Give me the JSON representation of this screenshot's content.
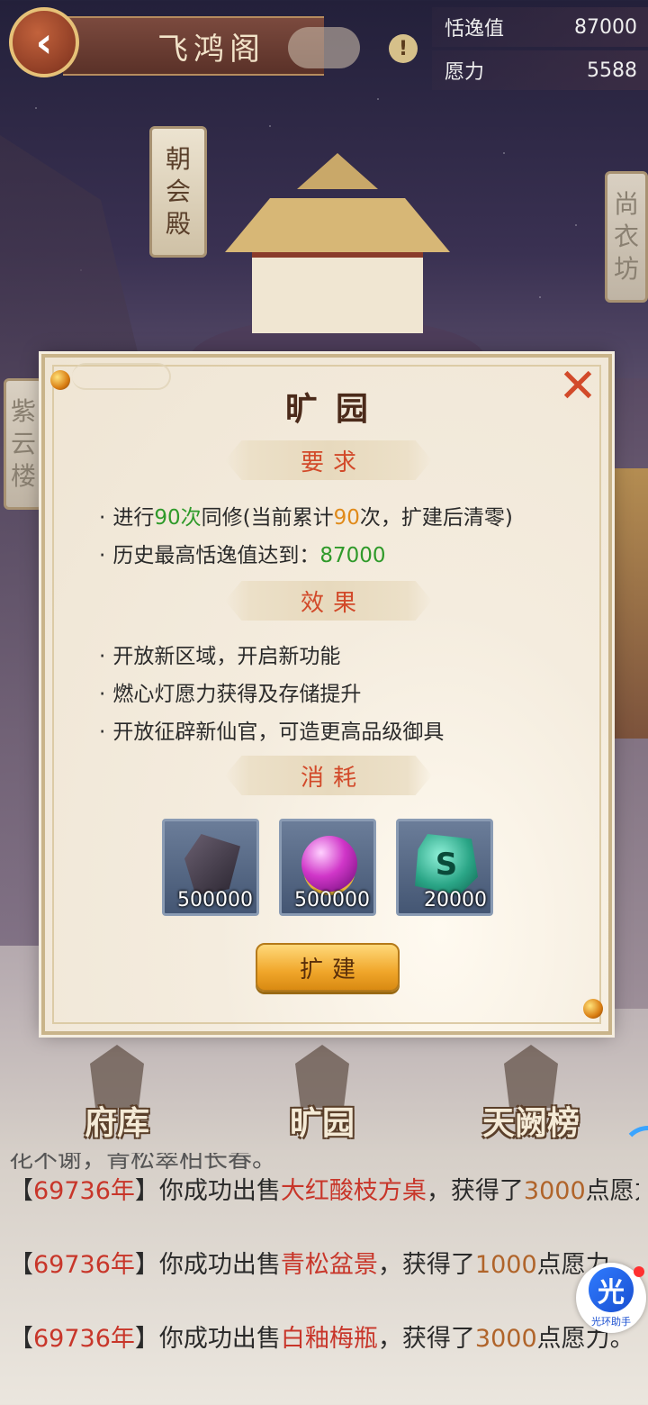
{
  "header": {
    "back_icon": "chevron-left-icon",
    "title": "飞鸿阁",
    "info_icon": "exclamation-icon",
    "stats": [
      {
        "label": "恬逸值",
        "value": "87000"
      },
      {
        "label": "愿力",
        "value": "5588"
      }
    ]
  },
  "scene_signs": {
    "chaohui": "朝会殿",
    "shangyi": "尚衣坊",
    "ziyun": "紫云楼"
  },
  "dialog": {
    "title": "旷园",
    "close_label": "✕",
    "requirements_head": "要求",
    "req1": {
      "prefix": "进行",
      "count": "90次",
      "mid": "同修(当前累计",
      "current": "90",
      "suffix": "次，扩建后清零)"
    },
    "req2": {
      "prefix": "历史最高恬逸值达到：",
      "value": "87000"
    },
    "effects_head": "效果",
    "effects": [
      "开放新区域，开启新功能",
      "燃心灯愿力获得及存储提升",
      "开放征辟新仙官，可造更高品级御具"
    ],
    "cost_head": "消耗",
    "costs": [
      {
        "icon": "dark-ore-icon",
        "amount": "500000"
      },
      {
        "icon": "purple-orb-icon",
        "amount": "500000"
      },
      {
        "icon": "jade-stone-icon",
        "amount": "20000"
      }
    ],
    "build_button": "扩建"
  },
  "bottom_nav": [
    {
      "label": "府库",
      "icon": "storehouse-icon"
    },
    {
      "label": "旷园",
      "icon": "garden-gate-icon"
    },
    {
      "label": "天阙榜",
      "icon": "ranking-board-icon"
    }
  ],
  "log": {
    "clipped_line": "花不谢，青松翠柏长春。",
    "entries": [
      {
        "year": "【",
        "year_num": "69736年",
        "year_close": "】",
        "text1": "你成功出售",
        "item": "大红酸枝方桌",
        "text2": "，获得了",
        "amount": "3000",
        "text3": "点愿力。"
      },
      {
        "year": "【",
        "year_num": "69736年",
        "year_close": "】",
        "text1": "你成功出售",
        "item": "青松盆景",
        "text2": "，获得了",
        "amount": "1000",
        "text3": "点愿力。"
      },
      {
        "year": "【",
        "year_num": "69736年",
        "year_close": "】",
        "text1": "你成功出售",
        "item": "白釉梅瓶",
        "text2": "，获得了",
        "amount": "3000",
        "text3": "点愿力。"
      }
    ]
  },
  "assistant": {
    "glyph": "光",
    "label": "光环助手"
  },
  "colors": {
    "accent_red": "#d24a2a",
    "green": "#2f9a2a",
    "orange": "#e08a1a",
    "button_gold": "#f0a62a"
  }
}
